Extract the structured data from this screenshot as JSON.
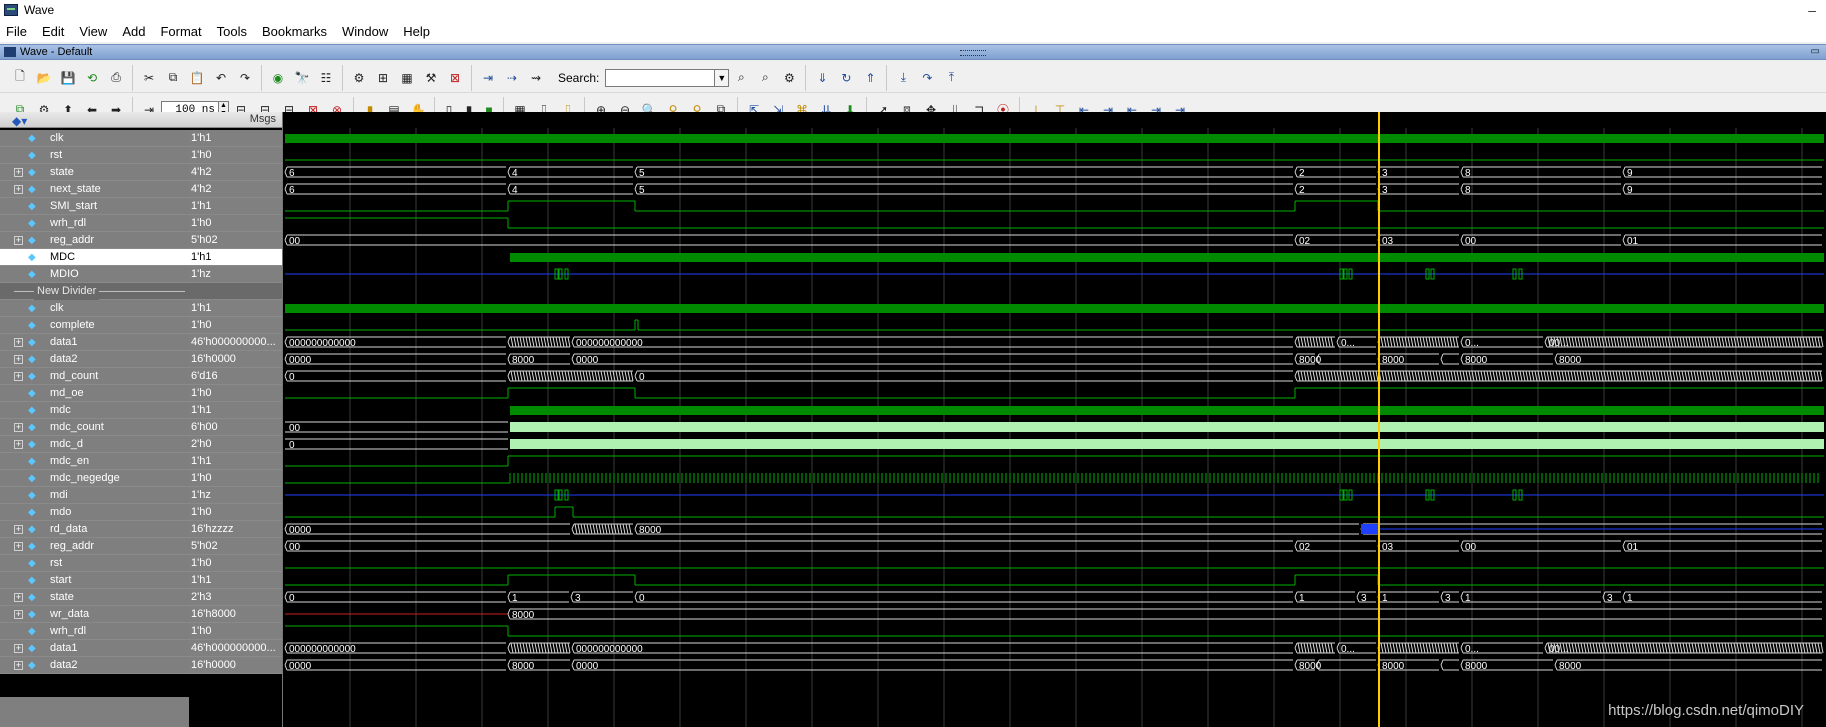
{
  "window": {
    "title": "Wave"
  },
  "menus": [
    "File",
    "Edit",
    "View",
    "Add",
    "Format",
    "Tools",
    "Bookmarks",
    "Window",
    "Help"
  ],
  "wave_window": {
    "title": "Wave - Default"
  },
  "toolbar": {
    "search_label": "Search:",
    "search_value": "",
    "time_value": "100 ns"
  },
  "panes": {
    "msgs_header": "Msgs"
  },
  "signals": [
    {
      "name": "clk",
      "value": "1'h1",
      "expand": false
    },
    {
      "name": "rst",
      "value": "1'h0",
      "expand": false
    },
    {
      "name": "state",
      "value": "4'h2",
      "expand": true
    },
    {
      "name": "next_state",
      "value": "4'h2",
      "expand": true
    },
    {
      "name": "SMI_start",
      "value": "1'h1",
      "expand": false
    },
    {
      "name": "wrh_rdl",
      "value": "1'h0",
      "expand": false
    },
    {
      "name": "reg_addr",
      "value": "5'h02",
      "expand": true
    },
    {
      "name": "MDC",
      "value": "1'h1",
      "expand": false,
      "selected": true
    },
    {
      "name": "MDIO",
      "value": "1'hz",
      "expand": false
    },
    {
      "name": "New Divider",
      "value": "",
      "divider": true
    },
    {
      "name": "clk",
      "value": "1'h1",
      "expand": false
    },
    {
      "name": "complete",
      "value": "1'h0",
      "expand": false
    },
    {
      "name": "data1",
      "value": "46'h000000000...",
      "expand": true
    },
    {
      "name": "data2",
      "value": "16'h0000",
      "expand": true
    },
    {
      "name": "md_count",
      "value": "6'd16",
      "expand": true
    },
    {
      "name": "md_oe",
      "value": "1'h0",
      "expand": false
    },
    {
      "name": "mdc",
      "value": "1'h1",
      "expand": false
    },
    {
      "name": "mdc_count",
      "value": "6'h00",
      "expand": true
    },
    {
      "name": "mdc_d",
      "value": "2'h0",
      "expand": true
    },
    {
      "name": "mdc_en",
      "value": "1'h1",
      "expand": false
    },
    {
      "name": "mdc_negedge",
      "value": "1'h0",
      "expand": false
    },
    {
      "name": "mdi",
      "value": "1'hz",
      "expand": false
    },
    {
      "name": "mdo",
      "value": "1'h0",
      "expand": false
    },
    {
      "name": "rd_data",
      "value": "16'hzzzz",
      "expand": true
    },
    {
      "name": "reg_addr",
      "value": "5'h02",
      "expand": true
    },
    {
      "name": "rst",
      "value": "1'h0",
      "expand": false
    },
    {
      "name": "start",
      "value": "1'h1",
      "expand": false
    },
    {
      "name": "state",
      "value": "2'h3",
      "expand": true
    },
    {
      "name": "wr_data",
      "value": "16'h8000",
      "expand": true
    },
    {
      "name": "wrh_rdl",
      "value": "1'h0",
      "expand": false
    },
    {
      "name": "data1",
      "value": "46'h000000000...",
      "expand": true
    },
    {
      "name": "data2",
      "value": "16'h0000",
      "expand": true
    }
  ],
  "bus_labels": {
    "state": [
      "6",
      "4",
      "5",
      "2",
      "3",
      "8",
      "9"
    ],
    "next_state": [
      "6",
      "4",
      "5",
      "2",
      "3",
      "8",
      "9"
    ],
    "reg_addr": [
      "00",
      "02",
      "03",
      "00",
      "01"
    ],
    "data1": [
      "000000000000",
      "000000000000",
      "0...",
      "0...",
      "00..."
    ],
    "data2": [
      "0000",
      "8000",
      "0000",
      "8000",
      "8000",
      "8000",
      "8000"
    ],
    "md_count": [
      "0",
      "0"
    ],
    "mdc_count": [
      "00"
    ],
    "mdc_d": [
      "0"
    ],
    "rd_data": [
      "0000",
      "8000"
    ],
    "reg_addr2": [
      "00",
      "02",
      "03",
      "00",
      "01"
    ],
    "state2": [
      "0",
      "1",
      "3",
      "0",
      "1",
      "3",
      "1",
      "3",
      "1",
      "3",
      "1"
    ],
    "wr_data": [
      "8000"
    ],
    "data1b": [
      "000000000000",
      "000000000000",
      "0...",
      "0...",
      "00..."
    ],
    "data2b": [
      "0000",
      "8000",
      "0000",
      "8000",
      "8000",
      "8000",
      "8000"
    ]
  },
  "watermark": "https://blog.csdn.net/qimoDIY",
  "colors": {
    "wave_green": "#00b000",
    "clock_fill": "#008a00",
    "cursor": "#ffcc00",
    "z_blue": "#2040ff",
    "bus_green": "#b0f0b0",
    "background": "#000000"
  }
}
